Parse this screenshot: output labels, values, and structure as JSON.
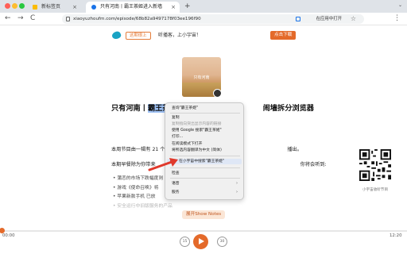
{
  "browser": {
    "tabs": [
      {
        "label": "新标签页"
      },
      {
        "label": "只有河南丨霸王茶姬进入新墙"
      }
    ],
    "new_tab": "+",
    "chevron": "⌄",
    "close": "×",
    "url": "xiaoyuzhoufm.com/episode/68b82a9497178f03ee196f90",
    "open_in_app": "在应用中打开",
    "nav": {
      "back": "←",
      "forward": "→",
      "reload": "C"
    },
    "star": "☆",
    "menu": "⋮"
  },
  "banner": {
    "tag": "这期很上",
    "text": "听播客，上小宇宙！",
    "button": "点击下载"
  },
  "cover": {
    "text": "只有河南"
  },
  "title": {
    "pre": "只有河南丨",
    "highlight": "霸王茶姬",
    "post": "闹墙拆分浏览器"
  },
  "body": {
    "p1_a": "本周节目由一辑有 21 个",
    "p1_b": "播出。",
    "p2_a": "本期早餐除为你带来",
    "p2_b": "你将会听到:",
    "list": [
      "蒲恋的市场下跌幅度则",
      "游戏《使命召唤》将",
      "苹果新款手机 已放",
      "安全运行中旧版服务的产品"
    ],
    "show_notes": "展开Show Notes"
  },
  "qr_caption": "小宇宙收听节目",
  "player": {
    "current": "00:00",
    "total": "12:20",
    "progress": 0.0,
    "back": "15",
    "fwd": "30"
  },
  "context_menu": {
    "search_jump": "查询\"霸王茶姬\"",
    "copy": "复制",
    "copy_link": "复制指向突出显示内容的链接",
    "google": "使用 Google 搜索\"霸王茶姬\"",
    "print": "打印...",
    "reader": "在阅读模式下打开",
    "translate": "将所选内容翻译为中文 (简体)",
    "xiaoyuzhou": "在小宇宙中搜索\"霸王茶姬\"",
    "inspect": "检查",
    "speech": "语音",
    "services": "服务",
    "submenu_arrow": "›"
  },
  "colors": {
    "accent": "#e46a2a",
    "highlight": "#9ec1f4",
    "brand": "#1aa3c4"
  }
}
